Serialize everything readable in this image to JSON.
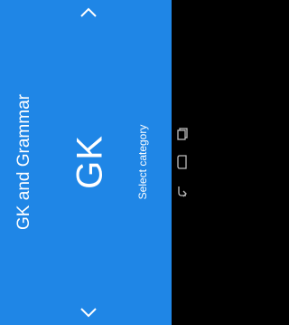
{
  "app": {
    "title": "GK and Grammar"
  },
  "card": {
    "heading": "GK",
    "hint": "Select category",
    "color": "#1f86e6"
  },
  "icons": {
    "up": "chevron-up-icon",
    "down": "chevron-down-icon",
    "recent": "recent-apps-icon",
    "home": "home-icon",
    "back": "back-icon"
  }
}
